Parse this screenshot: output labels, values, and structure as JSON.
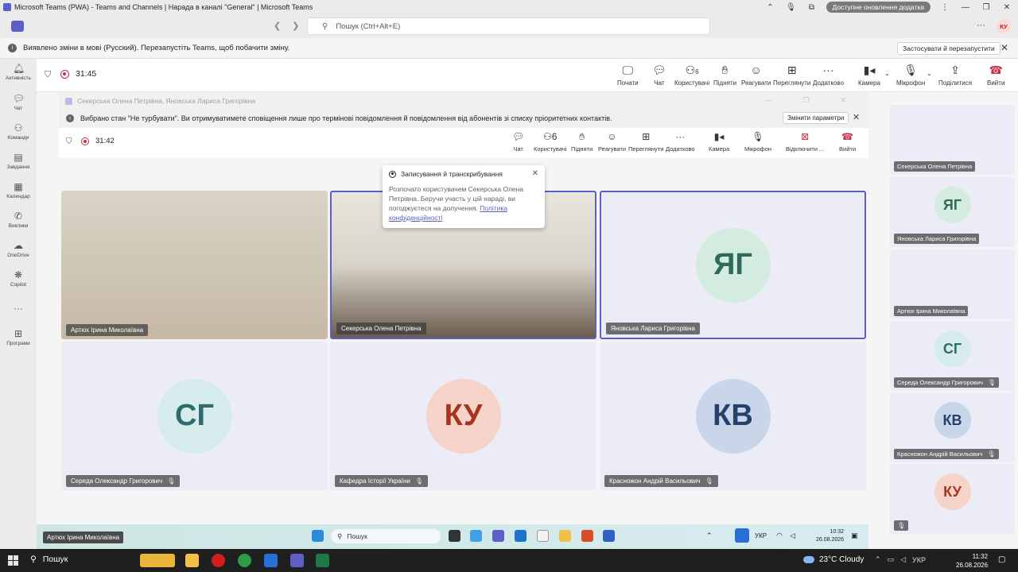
{
  "window": {
    "title": "Microsoft Teams (PWA) - Teams and Channels | Нарада в каналі \"General\" | Microsoft Teams",
    "update_label": "Доступне оновлення додатка"
  },
  "header": {
    "search_placeholder": "Пошук (Ctrl+Alt+E)",
    "avatar_initials": "КУ"
  },
  "notice": {
    "text": "Виявлено зміни в мові (Русский). Перезапустіть Teams, щоб побачити зміну.",
    "button": "Застосувати й перезапустити"
  },
  "rail": [
    {
      "label": "Активність",
      "icon": "bell-icon"
    },
    {
      "label": "Чат",
      "icon": "chat-icon"
    },
    {
      "label": "Команди",
      "icon": "teams-icon"
    },
    {
      "label": "Завдання",
      "icon": "tasks-icon"
    },
    {
      "label": "Календар",
      "icon": "calendar-icon"
    },
    {
      "label": "Виклики",
      "icon": "phone-icon"
    },
    {
      "label": "OneDrive",
      "icon": "cloud-icon"
    },
    {
      "label": "Copilot",
      "icon": "copilot-icon"
    },
    {
      "label": "",
      "icon": "more-icon"
    },
    {
      "label": "Програми",
      "icon": "apps-icon"
    }
  ],
  "meeting": {
    "timer": "31:45",
    "tools": {
      "start": "Почати",
      "chat": "Чат",
      "people": "Користувачі",
      "people_count": "6",
      "raise": "Підняти",
      "react": "Реагувати",
      "view": "Переглянути",
      "more": "Додатково",
      "camera": "Камера",
      "mic": "Мікрофон",
      "share": "Поділитися",
      "leave": "Вийти"
    }
  },
  "inner": {
    "title": "Секерська Олена Петрівна, Яновська Лариса Григорівна",
    "notice": "Вибрано стан \"Не турбувати\". Ви отримуватимете сповіщення лише про термінові повідомлення й повідомлення від абонентів зі списку пріоритетних контактів.",
    "notice_button": "Змінити параметри",
    "timer": "31:42",
    "tools": {
      "chat": "Чат",
      "people": "Користувачі",
      "people_count": "6",
      "raise": "Підняти",
      "react": "Реагувати",
      "view": "Переглянути",
      "more": "Додатково",
      "camera": "Камера",
      "mic": "Мікрофон",
      "hangup": "Відключити ...",
      "leave": "Вийти"
    }
  },
  "popup": {
    "title": "Записування й транскрибування",
    "body": "Розпочато користувачем Секерська Олена Петрівна. Беручи участь у цій нараді, ви погоджуєтеся на долучення.",
    "link": "Політика конфіденційності"
  },
  "tiles": [
    {
      "name": "Артюх Ірина Миколаївна",
      "initials": "",
      "photo": true
    },
    {
      "name": "Секерська Олена Петрівна",
      "initials": "",
      "photo": true
    },
    {
      "name": "Яновська Лариса Григорівна",
      "initials": "ЯГ",
      "color": "#2f6b5c",
      "bg": "#d4ebe0"
    },
    {
      "name": "Середа Олександр Григорович",
      "initials": "СГ",
      "color": "#2f6b6b",
      "bg": "#d6ecec"
    },
    {
      "name": "Кафедра Історії України",
      "initials": "КУ",
      "color": "#a7341f",
      "bg": "#f6d3c9"
    },
    {
      "name": "Красножон Андрій Васильович",
      "initials": "КВ",
      "color": "#24406b",
      "bg": "#c9d6ea"
    }
  ],
  "right_panel": [
    {
      "name": "Секерська Олена Петрівна",
      "initials": "",
      "photo": true
    },
    {
      "name": "Яновська Лариса Григорівна",
      "initials": "ЯГ",
      "color": "#2f6b5c",
      "bg": "#d4ebe0"
    },
    {
      "name": "Артюх Ірина Миколаївна",
      "initials": "",
      "photo": true
    },
    {
      "name": "Середа Олександр Григорович",
      "initials": "СГ",
      "color": "#2f6b6b",
      "bg": "#d6ecec"
    },
    {
      "name": "Красножон Андрій Васильович",
      "initials": "КВ",
      "color": "#24406b",
      "bg": "#c9d6ea"
    },
    {
      "name": "",
      "initials": "КУ",
      "color": "#a7341f",
      "bg": "#f6d3c9"
    }
  ],
  "inner_taskbar": {
    "search": "Пошук",
    "lang": "УКР",
    "time": "10:32",
    "date": "26.08.2026",
    "tooltip": "Артюх Ірина Миколаївна"
  },
  "taskbar": {
    "search": "Пошук",
    "weather": "23°C  Cloudy",
    "lang": "УКР",
    "time": "11:32",
    "date": "26.08.2026"
  }
}
